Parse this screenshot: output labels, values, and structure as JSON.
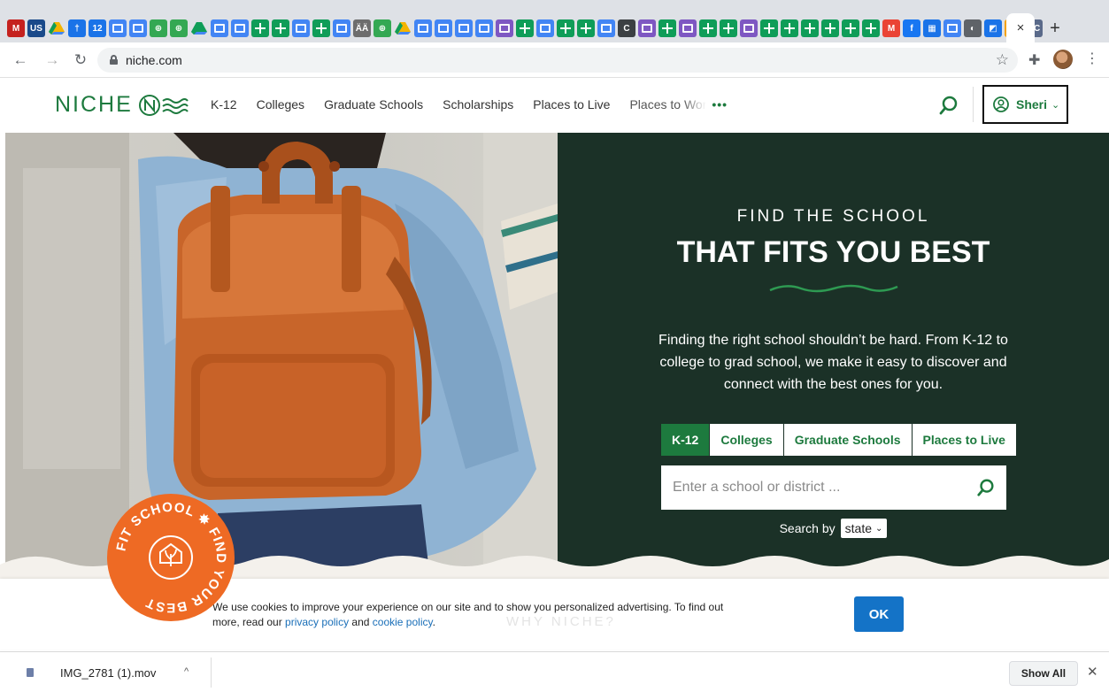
{
  "browser": {
    "url": "niche.com",
    "active_tab_close": "×",
    "new_tab": "+",
    "pinned_tabs": [
      {
        "kind": "letter",
        "text": "M",
        "color": "#c5221f"
      },
      {
        "kind": "letter",
        "text": "US",
        "color": "#1a4a8a"
      },
      {
        "kind": "drive",
        "color": "#f4b400"
      },
      {
        "kind": "letter",
        "text": "†",
        "color": "#1a73e8"
      },
      {
        "kind": "letter",
        "text": "12",
        "color": "#1a73e8"
      },
      {
        "kind": "doc",
        "color": "#4285f4"
      },
      {
        "kind": "doc",
        "color": "#4285f4"
      },
      {
        "kind": "letter",
        "text": "⊕",
        "color": "#34a853"
      },
      {
        "kind": "letter",
        "text": "⊕",
        "color": "#34a853"
      },
      {
        "kind": "drive",
        "color": "#0f9d58"
      },
      {
        "kind": "doc",
        "color": "#4285f4"
      },
      {
        "kind": "doc",
        "color": "#4285f4"
      },
      {
        "kind": "sheet",
        "color": "#0f9d58"
      },
      {
        "kind": "sheet",
        "color": "#0f9d58"
      },
      {
        "kind": "doc",
        "color": "#4285f4"
      },
      {
        "kind": "sheet",
        "color": "#0f9d58"
      },
      {
        "kind": "doc",
        "color": "#4285f4"
      },
      {
        "kind": "letter",
        "text": "ÄÄ",
        "color": "#6d6d6d"
      },
      {
        "kind": "letter",
        "text": "⊕",
        "color": "#34a853"
      },
      {
        "kind": "drive",
        "color": "#f4b400"
      },
      {
        "kind": "doc",
        "color": "#4285f4"
      },
      {
        "kind": "doc",
        "color": "#4285f4"
      },
      {
        "kind": "doc",
        "color": "#4285f4"
      },
      {
        "kind": "doc",
        "color": "#4285f4"
      },
      {
        "kind": "doc",
        "color": "#7e57c2"
      },
      {
        "kind": "sheet",
        "color": "#0f9d58"
      },
      {
        "kind": "doc",
        "color": "#4285f4"
      },
      {
        "kind": "sheet",
        "color": "#0f9d58"
      },
      {
        "kind": "sheet",
        "color": "#0f9d58"
      },
      {
        "kind": "doc",
        "color": "#4285f4"
      },
      {
        "kind": "letter",
        "text": "C",
        "color": "#3c4043"
      },
      {
        "kind": "doc",
        "color": "#7e57c2"
      },
      {
        "kind": "sheet",
        "color": "#0f9d58"
      },
      {
        "kind": "doc",
        "color": "#7e57c2"
      },
      {
        "kind": "sheet",
        "color": "#0f9d58"
      },
      {
        "kind": "sheet",
        "color": "#0f9d58"
      },
      {
        "kind": "doc",
        "color": "#7e57c2"
      },
      {
        "kind": "sheet",
        "color": "#0f9d58"
      },
      {
        "kind": "sheet",
        "color": "#0f9d58"
      },
      {
        "kind": "sheet",
        "color": "#0f9d58"
      },
      {
        "kind": "sheet",
        "color": "#0f9d58"
      },
      {
        "kind": "sheet",
        "color": "#0f9d58"
      },
      {
        "kind": "sheet",
        "color": "#0f9d58"
      },
      {
        "kind": "letter",
        "text": "M",
        "color": "#ea4335"
      },
      {
        "kind": "letter",
        "text": "f",
        "color": "#1877f2"
      },
      {
        "kind": "letter",
        "text": "▦",
        "color": "#1a73e8"
      },
      {
        "kind": "doc",
        "color": "#4285f4"
      },
      {
        "kind": "letter",
        "text": "◐",
        "color": "#5f6368"
      },
      {
        "kind": "letter",
        "text": "◩",
        "color": "#1a73e8"
      },
      {
        "kind": "letter",
        "text": "◆",
        "color": "#f4a100"
      },
      {
        "kind": "letter",
        "text": "AC",
        "color": "#5a6a8a"
      }
    ]
  },
  "header": {
    "logo_text": "NICHE",
    "nav": [
      "K-12",
      "Colleges",
      "Graduate Schools",
      "Scholarships",
      "Places to Live",
      "Places to Wor"
    ],
    "more": "•••",
    "user_name": "Sheri",
    "user_chevron": "⌄"
  },
  "hero": {
    "kicker": "FIND THE SCHOOL",
    "title": "THAT FITS YOU BEST",
    "description": "Finding the right school shouldn’t be hard. From K-12 to college to grad school, we make it easy to discover and connect with the best ones for you.",
    "tabs": [
      {
        "label": "K-12",
        "active": true
      },
      {
        "label": "Colleges",
        "active": false
      },
      {
        "label": "Graduate Schools",
        "active": false
      },
      {
        "label": "Places to Live",
        "active": false
      }
    ],
    "search_placeholder": "Enter a school or district ...",
    "search_by_label": "Search by",
    "search_by_value": "state",
    "colors": {
      "panel": "#1b3127",
      "accent": "#1d7a3e",
      "squiggle": "#2e9a52"
    }
  },
  "badge": {
    "text": "FIT SCHOOL ✸ FIND YOUR BEST",
    "color": "#ee6a24"
  },
  "cookie": {
    "text_before": "We use cookies to improve your experience on our site and to show you personalized advertising. To find out more, read our ",
    "privacy_link": "privacy policy",
    "and": " and ",
    "cookie_link": "cookie policy",
    "period": ".",
    "ok_label": "OK",
    "behind_text": "WHY NICHE?"
  },
  "downloads": {
    "file_name": "IMG_2781 (1).mov",
    "chevron": "^",
    "show_all": "Show All",
    "close": "✕"
  }
}
